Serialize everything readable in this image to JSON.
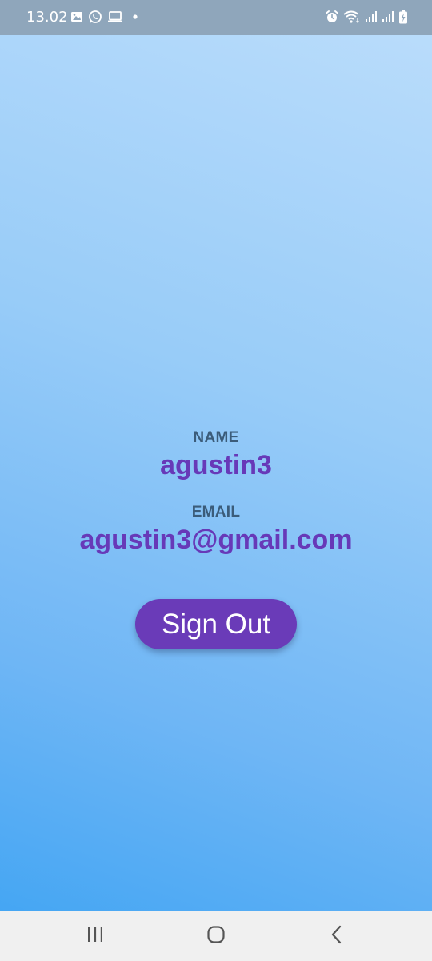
{
  "status_bar": {
    "time": "13.02",
    "left_icons": [
      "image-icon",
      "whatsapp-icon",
      "laptop-icon",
      "dot-icon"
    ],
    "right_icons": [
      "alarm-icon",
      "wifi-icon",
      "signal-icon",
      "signal-icon",
      "battery-charging-icon"
    ]
  },
  "profile": {
    "name_label": "NAME",
    "name_value": "agustin3",
    "email_label": "EMAIL",
    "email_value": "agustin3@gmail.com"
  },
  "actions": {
    "sign_out_label": "Sign Out"
  },
  "nav_bar": {
    "buttons": [
      "recents-icon",
      "home-icon",
      "back-icon"
    ]
  },
  "colors": {
    "accent": "#6a3bb8",
    "value_text": "#6739b8",
    "label_text": "#3b5c7a",
    "gradient_top": "#b9dcfb",
    "gradient_bottom": "#45a6f3",
    "status_bar": "#8fa6bb",
    "nav_bar": "#f0f0f0"
  }
}
